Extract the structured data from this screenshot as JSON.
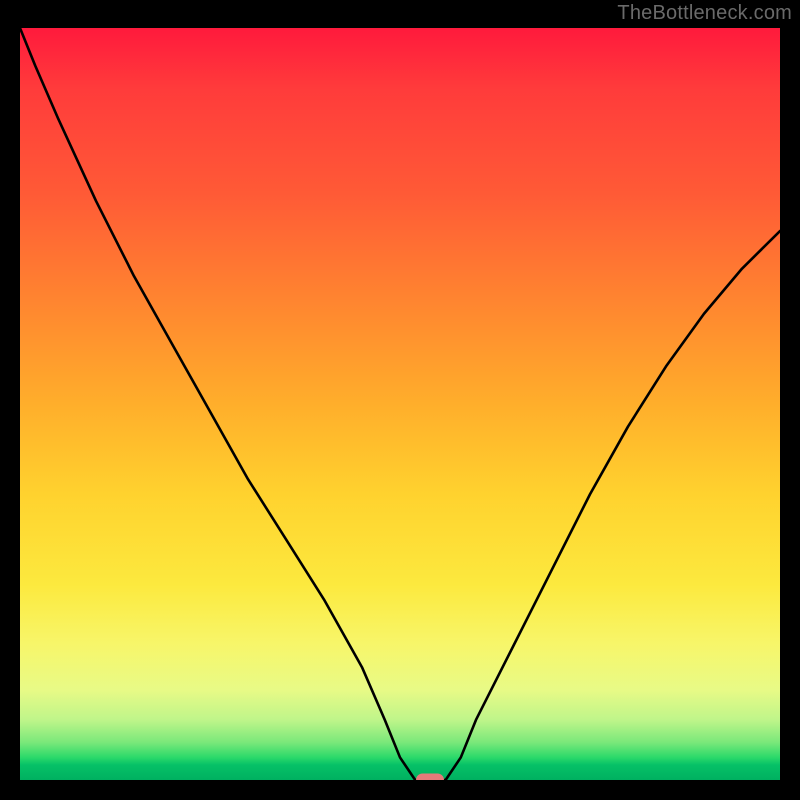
{
  "watermark": {
    "text": "TheBottleneck.com"
  },
  "chart_data": {
    "type": "line",
    "title": "",
    "xlabel": "",
    "ylabel": "",
    "xlim": [
      0,
      100
    ],
    "ylim": [
      0,
      100
    ],
    "grid": false,
    "legend": false,
    "x": [
      0,
      2,
      5,
      10,
      15,
      20,
      25,
      30,
      35,
      40,
      45,
      48,
      50,
      52,
      54,
      56,
      58,
      60,
      65,
      70,
      75,
      80,
      85,
      90,
      95,
      100
    ],
    "values": [
      100,
      95,
      88,
      77,
      67,
      58,
      49,
      40,
      32,
      24,
      15,
      8,
      3,
      0,
      0,
      0,
      3,
      8,
      18,
      28,
      38,
      47,
      55,
      62,
      68,
      73
    ],
    "marker": {
      "x": 54,
      "y": 0,
      "color": "#E47A7A"
    },
    "background_gradient": {
      "direction": "vertical",
      "stops": [
        {
          "pos": 0,
          "color": "#FF1A3C"
        },
        {
          "pos": 50,
          "color": "#FFAE2B"
        },
        {
          "pos": 82,
          "color": "#F7F66A"
        },
        {
          "pos": 100,
          "color": "#00B060"
        }
      ]
    }
  }
}
